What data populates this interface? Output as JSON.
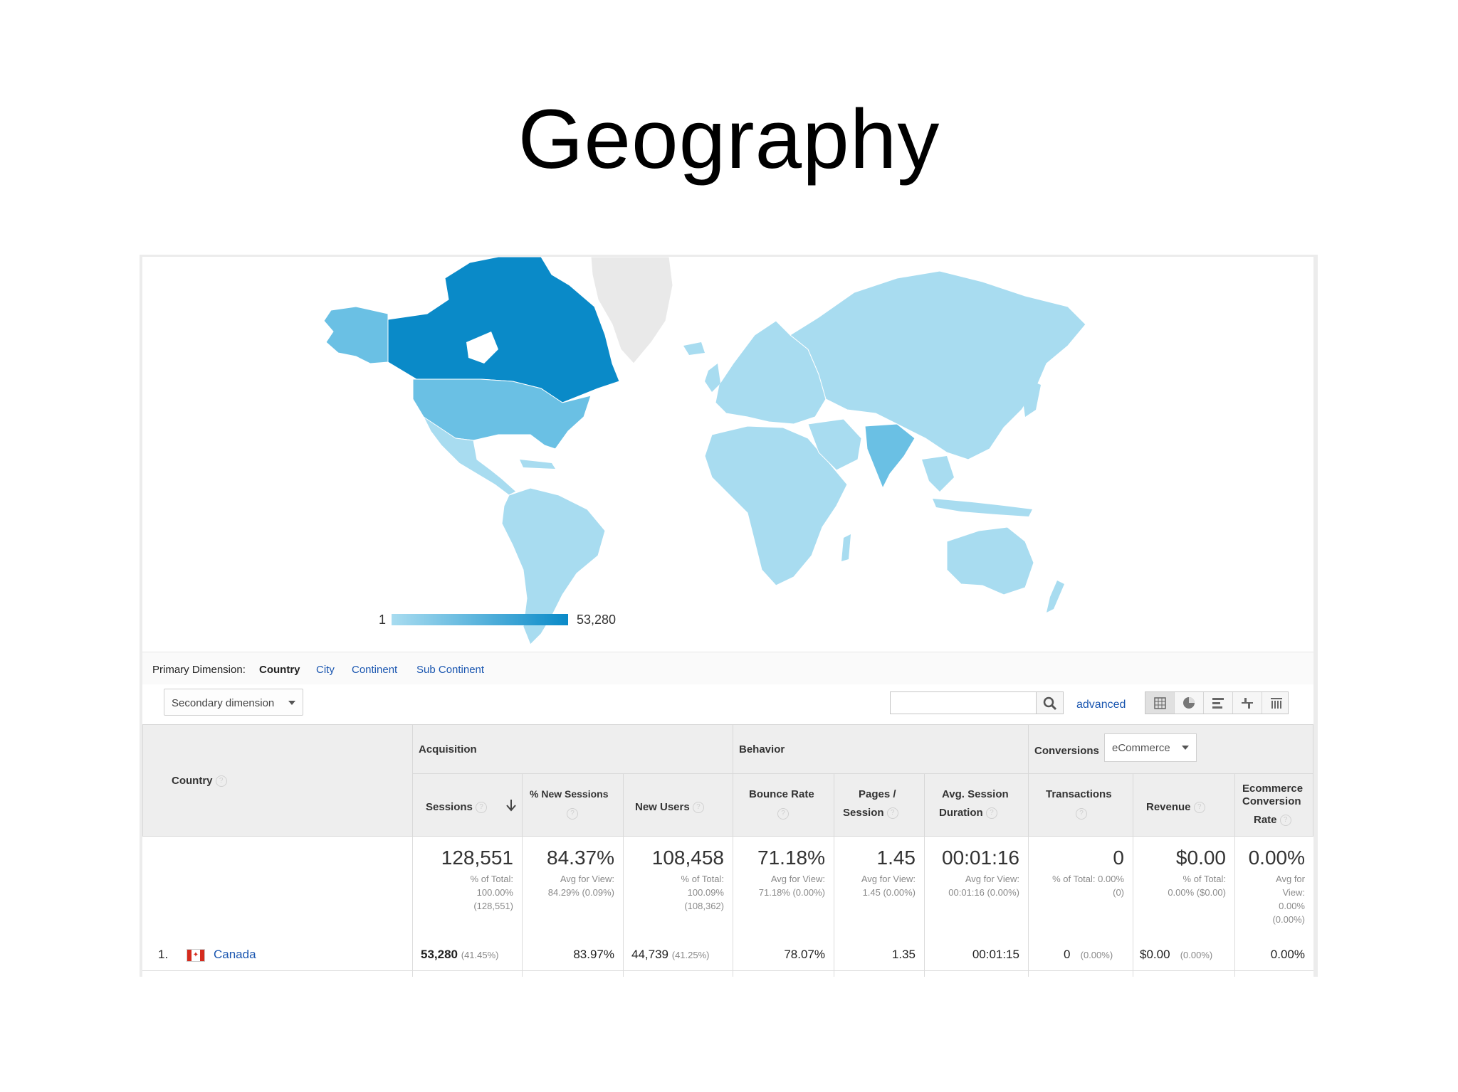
{
  "slide": {
    "title": "Geography"
  },
  "colors": {
    "high": "#0a8ac8",
    "mid": "#6ac0e4",
    "low": "#a8dcf0",
    "none": "#e9e9e9",
    "link": "#1a56b0"
  },
  "map": {
    "legend_min": "1",
    "legend_max": "53,280",
    "regions": [
      {
        "name": "Canada",
        "value": 53280
      },
      {
        "name": "United States",
        "value": null
      },
      {
        "name": "India",
        "value": null
      }
    ]
  },
  "dimension_bar": {
    "label": "Primary Dimension:",
    "items": [
      {
        "label": "Country",
        "active": true
      },
      {
        "label": "City",
        "active": false
      },
      {
        "label": "Continent",
        "active": false
      },
      {
        "label": "Sub Continent",
        "active": false
      }
    ]
  },
  "toolbar": {
    "secondary_dimension": "Secondary dimension",
    "search_value": "",
    "advanced": "advanced",
    "views": [
      "table-view-icon",
      "pie-view-icon",
      "bar-view-icon",
      "pivot-view-icon",
      "comparison-view-icon"
    ]
  },
  "table": {
    "groups": {
      "acquisition": "Acquisition",
      "behavior": "Behavior",
      "conversions": "Conversions",
      "conversion_select": "eCommerce"
    },
    "columns": {
      "country": "Country",
      "sessions": "Sessions",
      "new_sessions": "% New Sessions",
      "new_users": "New Users",
      "bounce_rate": "Bounce Rate",
      "pages_session_1": "Pages /",
      "pages_session_2": "Session",
      "avg_duration_1": "Avg. Session",
      "avg_duration_2": "Duration",
      "transactions": "Transactions",
      "revenue": "Revenue",
      "ecr_1": "Ecommerce",
      "ecr_2": "Conversion",
      "ecr_3": "Rate"
    },
    "totals": {
      "sessions": {
        "value": "128,551",
        "sub": [
          "% of Total:",
          "100.00%",
          "(128,551)"
        ]
      },
      "new_sessions": {
        "value": "84.37%",
        "sub": [
          "Avg for View:",
          "84.29% (0.09%)"
        ]
      },
      "new_users": {
        "value": "108,458",
        "sub": [
          "% of Total:",
          "100.09%",
          "(108,362)"
        ]
      },
      "bounce_rate": {
        "value": "71.18%",
        "sub": [
          "Avg for View:",
          "71.18% (0.00%)"
        ]
      },
      "pages_session": {
        "value": "1.45",
        "sub": [
          "Avg for View:",
          "1.45 (0.00%)"
        ]
      },
      "avg_duration": {
        "value": "00:01:16",
        "sub": [
          "Avg for View:",
          "00:01:16 (0.00%)"
        ]
      },
      "transactions": {
        "value": "0",
        "sub": [
          "% of Total: 0.00%",
          "(0)"
        ]
      },
      "revenue": {
        "value": "$0.00",
        "sub": [
          "% of Total:",
          "0.00% ($0.00)"
        ]
      },
      "ecr": {
        "value": "0.00%",
        "sub": [
          "Avg for",
          "View:",
          "0.00%",
          "(0.00%)"
        ]
      }
    },
    "rows": [
      {
        "index": "1.",
        "country": "Canada",
        "flag": "canada-flag-icon",
        "sessions": "53,280",
        "sessions_pct": "(41.45%)",
        "new_sessions": "83.97%",
        "new_users": "44,739",
        "new_users_pct": "(41.25%)",
        "bounce_rate": "78.07%",
        "pages_session": "1.35",
        "avg_duration": "00:01:15",
        "transactions": "0",
        "transactions_pct": "(0.00%)",
        "revenue": "$0.00",
        "revenue_pct": "(0.00%)",
        "ecr": "0.00%"
      }
    ]
  }
}
